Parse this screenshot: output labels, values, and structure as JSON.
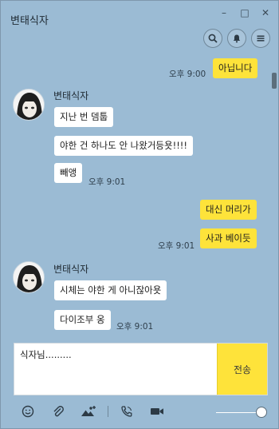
{
  "window": {
    "title": "변태식자",
    "controls": [
      "–",
      "□",
      "✕"
    ]
  },
  "header_icons": [
    "search-icon",
    "bell-icon",
    "menu-icon"
  ],
  "messages": {
    "m1": {
      "text": "아닙니다",
      "time": "오후 9:00"
    },
    "group1": {
      "sender": "변태식자",
      "lines": [
        "지난 번 뎀툽",
        "야한 건 하나도 안 나왔거등욧!!!!",
        "빼앵"
      ],
      "time": "오후 9:01"
    },
    "mine2": {
      "lines": [
        "대신 머리가",
        "사과 베이듯"
      ],
      "time": "오후 9:01"
    },
    "group2": {
      "sender": "변태식자",
      "lines": [
        "시체는 야한 게 아니잖아욧",
        "다이조부 옹"
      ],
      "time": "오후 9:01"
    }
  },
  "input": {
    "value": "식자님........."
  },
  "send_label": "전송",
  "toolbar": [
    "emoji-icon",
    "attach-icon",
    "image-icon",
    "call-icon",
    "video-icon"
  ],
  "colors": {
    "background": "#9bbbd4",
    "my_bubble": "#fee33a",
    "their_bubble": "#ffffff"
  }
}
